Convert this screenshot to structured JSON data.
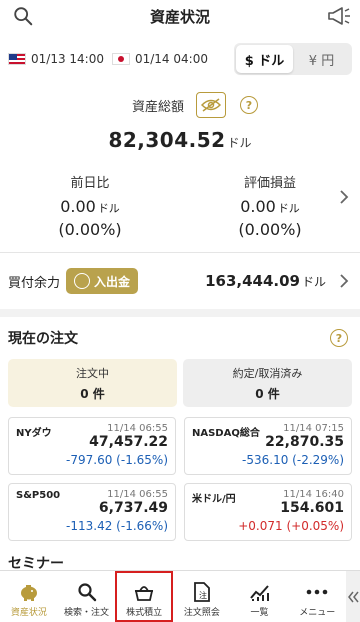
{
  "header": {
    "title": "資産状況"
  },
  "timebar": {
    "us_time": "01/13 14:00",
    "jp_time": "01/14 04:00",
    "currency_options": [
      "$ ドル",
      "¥ 円"
    ]
  },
  "assets": {
    "label": "資産総額",
    "total": "82,304.52",
    "unit": "ドル",
    "prev_day": {
      "label": "前日比",
      "value": "0.00",
      "unit": "ドル",
      "pct": "(0.00%)"
    },
    "valuation": {
      "label": "評価損益",
      "value": "0.00",
      "unit": "ドル",
      "pct": "(0.00%)"
    }
  },
  "buying": {
    "label": "買付余力",
    "deposit_button": "入出金",
    "amount": "163,444.09",
    "unit": "ドル"
  },
  "orders": {
    "title": "現在の注文",
    "pending_label": "注文中",
    "pending_count": "0 件",
    "done_label": "約定/取消済み",
    "done_count": "0 件"
  },
  "markets": [
    {
      "name": "NYダウ",
      "time": "11/14 06:55",
      "price": "47,457.22",
      "change": "-797.60 (-1.65%)",
      "dir": "neg"
    },
    {
      "name": "NASDAQ総合",
      "time": "11/14 07:15",
      "price": "22,870.35",
      "change": "-536.10 (-2.29%)",
      "dir": "neg"
    },
    {
      "name": "S&P500",
      "time": "11/14 06:55",
      "price": "6,737.49",
      "change": "-113.42 (-1.66%)",
      "dir": "neg"
    },
    {
      "name": "米ドル/円",
      "time": "11/14 16:40",
      "price": "154.601",
      "change": "+0.071 (+0.05%)",
      "dir": "pos"
    }
  ],
  "seminar": {
    "title": "セミナー"
  },
  "tabs": [
    {
      "label": "資産状況",
      "icon": "piggy-bank-icon",
      "active": true
    },
    {
      "label": "検索・注文",
      "icon": "search-icon"
    },
    {
      "label": "株式積立",
      "icon": "basket-icon",
      "highlighted": true
    },
    {
      "label": "注文照会",
      "icon": "order-doc-icon"
    },
    {
      "label": "一覧",
      "icon": "chart-icon"
    },
    {
      "label": "メニュー",
      "icon": "more-icon"
    }
  ],
  "colors": {
    "gold": "#b89b3c",
    "negative": "#1c5fb5",
    "positive": "#d22b2b",
    "highlight": "#d61f1f"
  }
}
